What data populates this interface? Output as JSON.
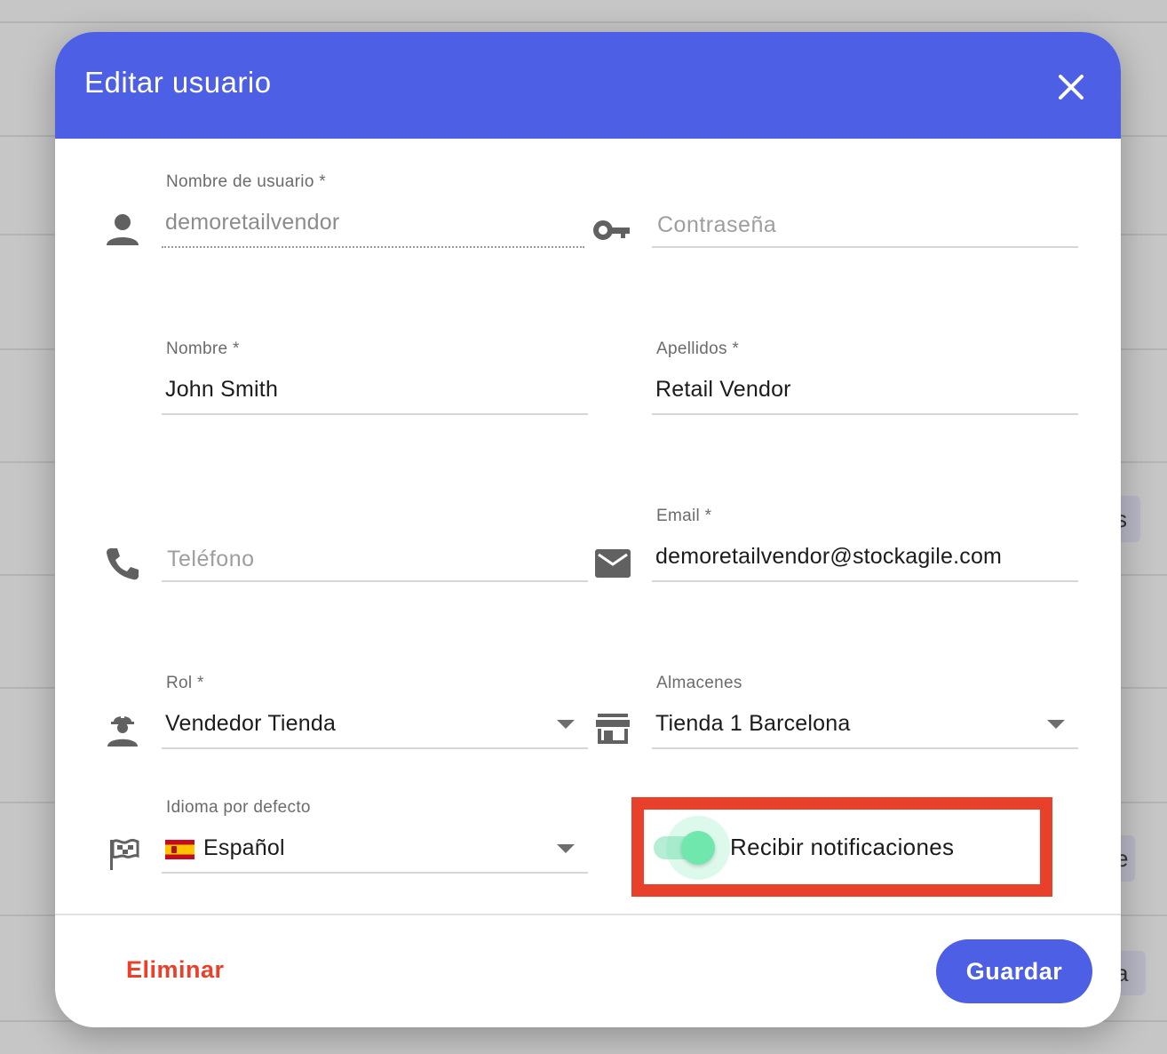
{
  "dialog": {
    "title": "Editar usuario",
    "close_icon": "close-icon"
  },
  "background": {
    "chip_texts": [
      "s",
      "e",
      "a"
    ]
  },
  "form": {
    "username": {
      "label": "Nombre de usuario *",
      "value": "demoretailvendor",
      "icon": "person-icon"
    },
    "password": {
      "placeholder": "Contraseña",
      "icon": "key-icon"
    },
    "first_name": {
      "label": "Nombre *",
      "value": "John Smith"
    },
    "last_name": {
      "label": "Apellidos *",
      "value": "Retail Vendor"
    },
    "phone": {
      "placeholder": "Teléfono",
      "icon": "phone-icon"
    },
    "email": {
      "label": "Email *",
      "value": "demoretailvendor@stockagile.com",
      "icon": "mail-icon"
    },
    "role": {
      "label": "Rol *",
      "value": "Vendedor Tienda",
      "icon": "worker-icon"
    },
    "warehouses": {
      "label": "Almacenes",
      "value": "Tienda 1 Barcelona",
      "icon": "store-icon"
    },
    "language": {
      "label": "Idioma por defecto",
      "value": "Español",
      "icon": "flag-icon",
      "flag": "spain-flag-icon"
    },
    "notifications": {
      "label": "Recibir notificaciones",
      "checked": true
    }
  },
  "footer": {
    "delete_label": "Eliminar",
    "save_label": "Guardar"
  },
  "colors": {
    "header": "#4c5fe5",
    "save_button": "#4c5fe5",
    "delete_text": "#e8402a",
    "highlight_border": "#e8402a",
    "toggle_on": "#6fe7ad"
  }
}
